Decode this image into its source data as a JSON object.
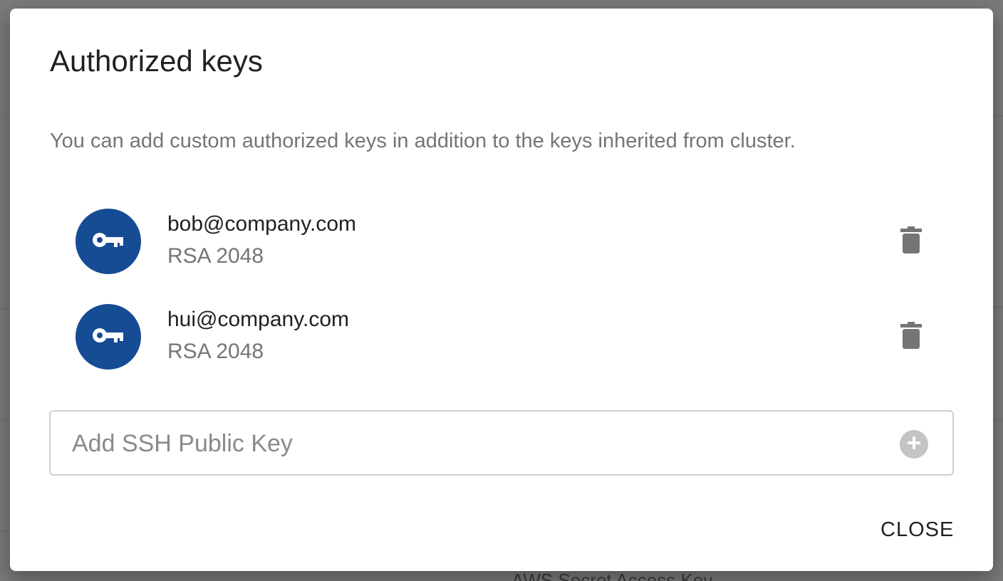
{
  "background": {
    "partial_text": "AWS Secret Access Key"
  },
  "dialog": {
    "title": "Authorized keys",
    "description": "You can add custom authorized keys in addition to the keys inherited from cluster.",
    "keys": [
      {
        "name": "bob@company.com",
        "type": "RSA 2048",
        "icon": "key-icon",
        "action_icon": "trash-icon"
      },
      {
        "name": "hui@company.com",
        "type": "RSA 2048",
        "icon": "key-icon",
        "action_icon": "trash-icon"
      }
    ],
    "add_field": {
      "placeholder": "Add SSH Public Key",
      "value": "",
      "button_icon": "plus-circle-icon"
    },
    "close_label": "CLOSE"
  },
  "colors": {
    "avatar_bg": "#154c94",
    "overlay": "#7a7a7a",
    "icon_gray": "#757575"
  }
}
